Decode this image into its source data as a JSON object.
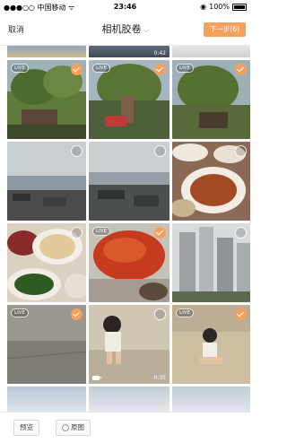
{
  "status_bar": {
    "carrier": "●●●○○ 中国移动 ᯤ",
    "time": "23:46",
    "battery": "100%"
  },
  "nav": {
    "cancel": "取消",
    "title": "相机胶卷",
    "next": "下一步(6)"
  },
  "photos": [
    {
      "live": false,
      "selected": false,
      "video": true,
      "duration": "0:42"
    },
    {
      "live": true,
      "selected": true,
      "video": false,
      "duration": ""
    },
    {
      "live": true,
      "selected": true,
      "video": false,
      "duration": ""
    },
    {
      "live": true,
      "selected": true,
      "video": false,
      "duration": ""
    },
    {
      "live": false,
      "selected": false,
      "video": false,
      "duration": ""
    },
    {
      "live": false,
      "selected": false,
      "video": false,
      "duration": ""
    },
    {
      "live": false,
      "selected": false,
      "video": false,
      "duration": ""
    },
    {
      "live": false,
      "selected": false,
      "video": false,
      "duration": ""
    },
    {
      "live": false,
      "selected": false,
      "video": false,
      "duration": ""
    },
    {
      "live": false,
      "selected": false,
      "video": false,
      "duration": ""
    },
    {
      "live": true,
      "selected": true,
      "video": false,
      "duration": ""
    },
    {
      "live": false,
      "selected": false,
      "video": false,
      "duration": ""
    },
    {
      "live": true,
      "selected": true,
      "video": false,
      "duration": ""
    },
    {
      "live": false,
      "selected": false,
      "video": true,
      "duration": "0:35"
    },
    {
      "live": true,
      "selected": true,
      "video": false,
      "duration": ""
    }
  ],
  "live_label": "LIVE",
  "bottom": {
    "preview": "预览",
    "original": "原图"
  },
  "colors": {
    "accent": "#f5a15e"
  }
}
